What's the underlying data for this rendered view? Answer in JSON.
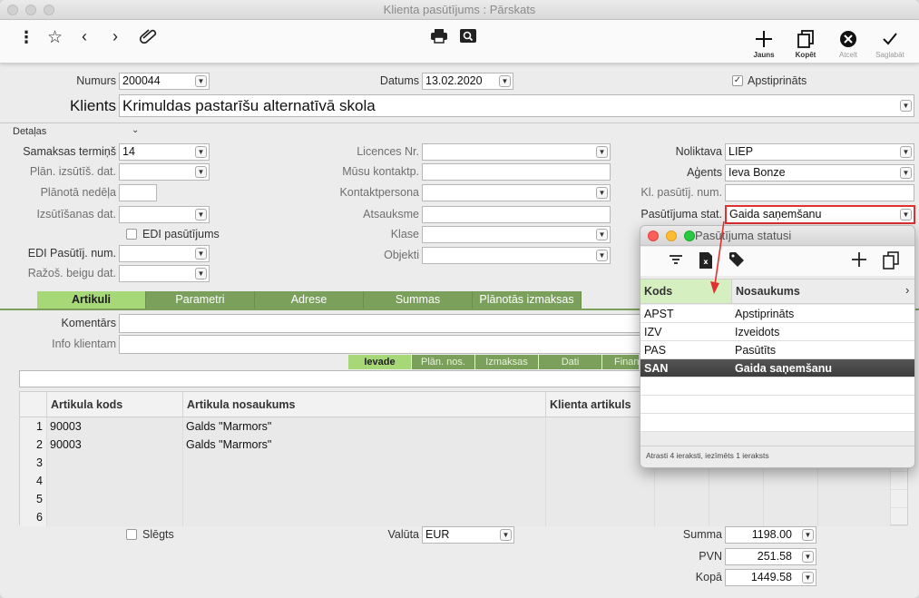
{
  "window": {
    "title": "Klienta pasūtījums : Pārskats"
  },
  "toolbar": {
    "new_label": "Jauns",
    "copy_label": "Kopēt",
    "cancel_label": "Atcelt",
    "save_label": "Saglabāt"
  },
  "header": {
    "number_label": "Numurs",
    "number_value": "200044",
    "date_label": "Datums",
    "date_value": "13.02.2020",
    "approved_label": "Apstiprināts",
    "approved_checked": true,
    "client_label": "Klients",
    "client_value": "Krimuldas pastarīšu alternatīvā skola"
  },
  "details": {
    "section_label": "Detaļas",
    "payment_term_label": "Samaksas termiņš",
    "payment_term_value": "14",
    "planned_ship_date_label": "Plān. izsūtīš. dat.",
    "planned_week_label": "Plānotā nedēļa",
    "ship_date_label": "Izsūtīšanas dat.",
    "edi_order_label": "EDI pasūtījums",
    "edi_order_num_label": "EDI Pasūtīj. num.",
    "production_end_label": "Ražoš. beigu dat.",
    "licence_label": "Licences Nr.",
    "our_contact_label": "Mūsu kontaktp.",
    "contact_person_label": "Kontaktpersona",
    "reference_label": "Atsauksme",
    "class_label": "Klase",
    "objects_label": "Objekti",
    "warehouse_label": "Noliktava",
    "warehouse_value": "LIEP",
    "agent_label": "Aģents",
    "agent_value": "Ieva Bonze",
    "client_order_num_label": "Kl. pasūtīj. num.",
    "order_status_label": "Pasūtījuma stat.",
    "order_status_value": "Gaida saņemšanu"
  },
  "tabs": [
    "Artikuli",
    "Parametri",
    "Adrese",
    "Summas",
    "Plānotās izmaksas"
  ],
  "comments": {
    "comment_label": "Komentārs",
    "info_label": "Info klientam"
  },
  "subtabs": [
    "Ievade",
    "Plān. nos.",
    "Izmaksas",
    "Dati",
    "Finans"
  ],
  "grid": {
    "headers": [
      "Artikula kods",
      "Artikula nosaukums",
      "Klienta artikuls"
    ],
    "rows": [
      {
        "num": "1",
        "code": "90003",
        "name": "Galds \"Marmors\""
      },
      {
        "num": "2",
        "code": "90003",
        "name": "Galds \"Marmors\""
      },
      {
        "num": "3",
        "code": "",
        "name": ""
      },
      {
        "num": "4",
        "code": "",
        "name": ""
      },
      {
        "num": "5",
        "code": "",
        "name": ""
      },
      {
        "num": "6",
        "code": "",
        "name": ""
      }
    ]
  },
  "footer": {
    "closed_label": "Slēgts",
    "currency_label": "Valūta",
    "currency_value": "EUR",
    "sum_label": "Summa",
    "sum_value": "1198.00",
    "vat_label": "PVN",
    "vat_value": "251.58",
    "total_label": "Kopā",
    "total_value": "1449.58"
  },
  "popup": {
    "title": "Pasūtījuma statusi",
    "col_code": "Kods",
    "col_name": "Nosaukums",
    "rows": [
      {
        "code": "APST",
        "name": "Apstiprināts"
      },
      {
        "code": "IZV",
        "name": "Izveidots"
      },
      {
        "code": "PAS",
        "name": "Pasūtīts"
      },
      {
        "code": "SAN",
        "name": "Gaida saņemšanu"
      }
    ],
    "footer": "Atrasti 4 ieraksti, iezīmēts 1 ieraksts"
  },
  "colors": {
    "accent_green": "#7ba05b",
    "active_green": "#a6d877",
    "highlight_red": "#e03030"
  }
}
